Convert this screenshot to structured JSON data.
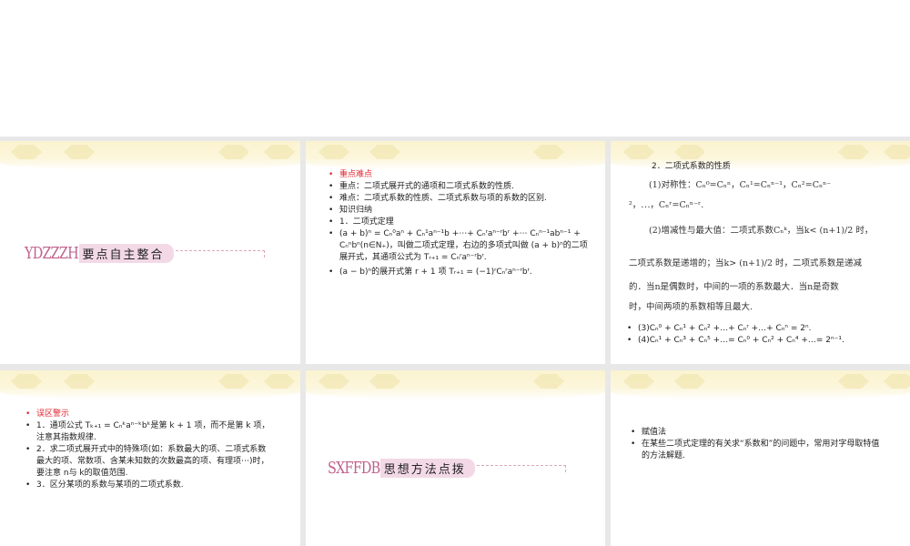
{
  "slides": [
    {
      "abbr": "YDZZZH",
      "title": "要点自主整合"
    },
    {
      "bullets": [
        "重点难点",
        "重点：二项式展开式的通项和二项式系数的性质.",
        "难点：二项式系数的性质、二项式系数与项的系数的区别.",
        "知识归纳",
        "1．二项式定理",
        "(a + b)ⁿ = Cₙ⁰aⁿ + Cₙ¹aⁿ⁻¹b +⋯+ Cₙʳaⁿ⁻ʳbʳ +⋯ Cₙⁿ⁻¹abⁿ⁻¹ + Cₙⁿbⁿ(n∈N₊)，叫做二项式定理，右边的多项式叫做 (a + b)ⁿ的二项展开式，其通项公式为 Tᵣ₊₁ = Cₙʳaⁿ⁻ʳbʳ.",
        "(a − b)ⁿ的展开式第 r + 1 项 Tᵣ₊₁ = (−1)ʳCₙʳaⁿ⁻ʳbʳ."
      ]
    },
    {
      "heading": "2．二项式系数的性质",
      "p1a": "(1)对称性：Cₙ⁰=Cₙⁿ，Cₙ¹=Cₙⁿ⁻¹，Cₙ²=Cₙⁿ⁻",
      "p1b": "²，⋯，Cₙʳ=Cₙⁿ⁻ʳ.",
      "p2": "(2)增减性与最大值：二项式系数Cₙᵏ，当k< (n+1)/2 时，",
      "p3": "二项式系数是递增的；当k> (n+1)/2 时，二项式系数是递减",
      "p4": "的．当n是偶数时，中间的一项的系数最大．当n是奇数",
      "p5": "时，中间两项的系数相等且最大.",
      "bullets": [
        "(3)Cₙ⁰ + Cₙ¹ + Cₙ² +…+ Cₙʳ +…+ Cₙⁿ = 2ⁿ.",
        "(4)Cₙ¹ + Cₙ³ + Cₙ⁵ +…= Cₙ⁰ + Cₙ² + Cₙ⁴ +…= 2ⁿ⁻¹."
      ]
    },
    {
      "bullets": [
        "误区警示",
        "1．通项公式 Tₖ₊₁ = Cₙᵏaⁿ⁻ᵏbᵏ是第 k + 1 项，而不是第 k 项，注意其指数规律.",
        "2．求二项式展开式中的特殊项(如：系数最大的项、二项式系数最大的项、常数项、含某未知数的次数最高的项、有理项⋯)时，要注意 n与 k的取值范围.",
        "3．区分某项的系数与某项的二项式系数."
      ]
    },
    {
      "abbr": "SXFFDB",
      "title": "思想方法点拨"
    },
    {
      "bullets": [
        "赋值法",
        "在某些二项式定理的有关求“系数和”的问题中，常用对字母取特值的方法解题."
      ]
    }
  ]
}
